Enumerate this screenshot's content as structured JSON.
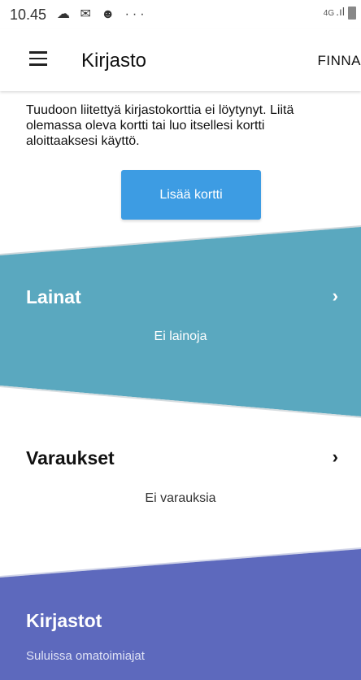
{
  "statusbar": {
    "time": "10.45",
    "notification_icons": "☁ ✉ ☻  ···",
    "network": "4G"
  },
  "appbar": {
    "title": "Kirjasto",
    "right_label": "FINNA"
  },
  "notice": {
    "text": "Tuudoon liitettyä kirjastokorttia ei löytynyt. Liitä olemassa oleva kortti tai luo itsellesi kortti aloittaaksesi käyttö."
  },
  "add_card_button": {
    "label": "Lisää kortti"
  },
  "sections": {
    "lainat": {
      "title": "Lainat",
      "subtitle": "Ei lainoja"
    },
    "varaukset": {
      "title": "Varaukset",
      "subtitle": "Ei varauksia"
    },
    "kirjastot": {
      "title": "Kirjastot",
      "subtitle": "Suluissa omatoimiajat"
    }
  },
  "colors": {
    "accent_button": "#3d9ce3",
    "lainat_bg": "#5aa8bf",
    "kirjastot_bg": "#5d69bd"
  },
  "icons": {
    "menu": "hamburger-menu-icon",
    "chevron": "chevron-right-icon"
  }
}
